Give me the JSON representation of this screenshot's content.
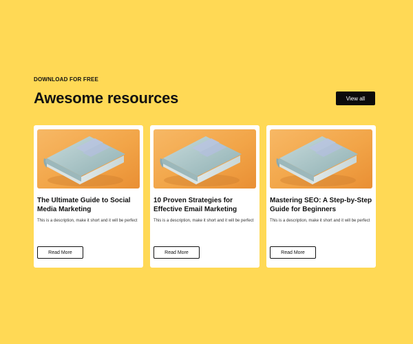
{
  "section": {
    "eyebrow": "DOWNLOAD FOR FREE",
    "title": "Awesome resources",
    "view_all_label": "View all"
  },
  "cards": [
    {
      "title": "The Ultimate Guide to Social Media Marketing",
      "description": "This is a description, make it short and it will be perfect",
      "button_label": "Read More"
    },
    {
      "title": "10 Proven Strategies for Effective Email Marketing",
      "description": "This is a description, make it short and it will be perfect",
      "button_label": "Read More"
    },
    {
      "title": "Mastering SEO: A Step-by-Step Guide for Beginners",
      "description": "This is a description, make it short and it will be perfect",
      "button_label": "Read More"
    }
  ],
  "colors": {
    "background": "#ffd955",
    "card": "#ffffff",
    "button_dark": "#0b0b0b",
    "thumbnail_bg": "#f0a548",
    "book_cover": "#a9c4c5"
  },
  "icons": {
    "thumbnail": "book-illustration"
  }
}
